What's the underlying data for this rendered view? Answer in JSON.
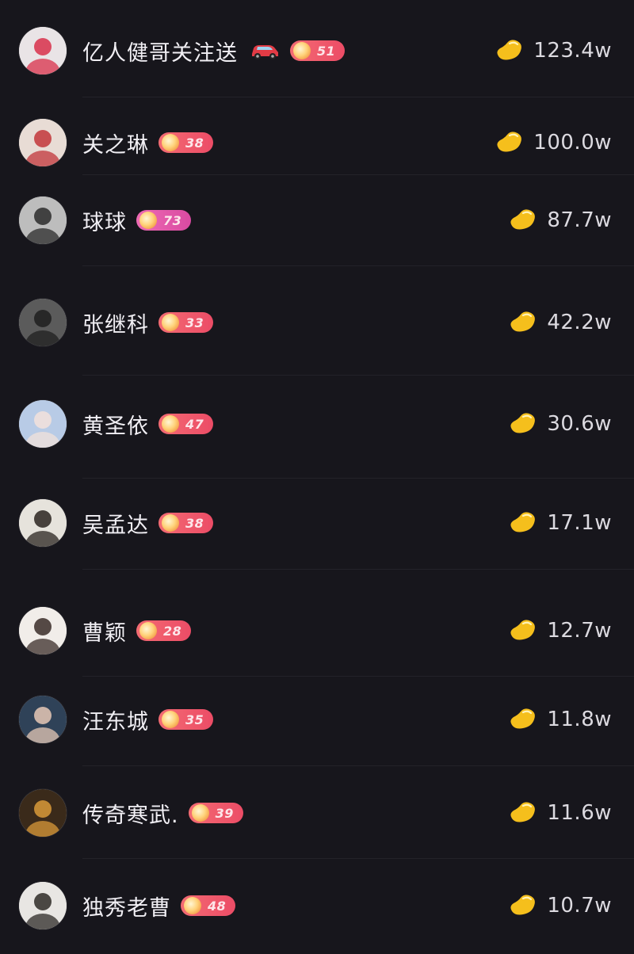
{
  "rows": [
    {
      "name": "亿人健哥关注送",
      "has_car": true,
      "level": "51",
      "badge_color": "red",
      "value": "123.4w",
      "avatar_colors": [
        "#e9e4e6",
        "#d8304a"
      ]
    },
    {
      "name": "关之琳",
      "has_car": false,
      "level": "38",
      "badge_color": "red",
      "value": "100.0w",
      "avatar_colors": [
        "#e8dcd5",
        "#c2363a"
      ]
    },
    {
      "name": "球球",
      "has_car": false,
      "level": "73",
      "badge_color": "pink",
      "value": "87.7w",
      "avatar_colors": [
        "#bdbdbd",
        "#2b2b2b"
      ]
    },
    {
      "name": "张继科",
      "has_car": false,
      "level": "33",
      "badge_color": "red",
      "value": "42.2w",
      "avatar_colors": [
        "#5b5b5b",
        "#1f1f1f"
      ]
    },
    {
      "name": "黄圣依",
      "has_car": false,
      "level": "47",
      "badge_color": "red",
      "value": "30.6w",
      "avatar_colors": [
        "#b8cbe6",
        "#f2e2da"
      ]
    },
    {
      "name": "吴孟达",
      "has_car": false,
      "level": "38",
      "badge_color": "red",
      "value": "17.1w",
      "avatar_colors": [
        "#e6e3dc",
        "#2a2420"
      ]
    },
    {
      "name": "曹颖",
      "has_car": false,
      "level": "28",
      "badge_color": "red",
      "value": "12.7w",
      "avatar_colors": [
        "#f1ede9",
        "#3a2c28"
      ]
    },
    {
      "name": "汪东城",
      "has_car": false,
      "level": "35",
      "badge_color": "red",
      "value": "11.8w",
      "avatar_colors": [
        "#2f4258",
        "#e6c8b6"
      ]
    },
    {
      "name": "传奇寒武.",
      "has_car": false,
      "level": "39",
      "badge_color": "red",
      "value": "11.6w",
      "avatar_colors": [
        "#3a2a1a",
        "#d99a3a"
      ]
    },
    {
      "name": "独秀老曹",
      "has_car": false,
      "level": "48",
      "badge_color": "red",
      "value": "10.7w",
      "avatar_colors": [
        "#e8e6e3",
        "#2e2a27"
      ]
    }
  ],
  "colors": {
    "background": "#17161c",
    "badge_red": "#ef5b6c",
    "badge_pink": "#e45aab",
    "bean": "#f5bf1c"
  },
  "icons": {
    "car": "car-icon",
    "bean": "bean-icon",
    "badge": "fan-badge-icon"
  }
}
